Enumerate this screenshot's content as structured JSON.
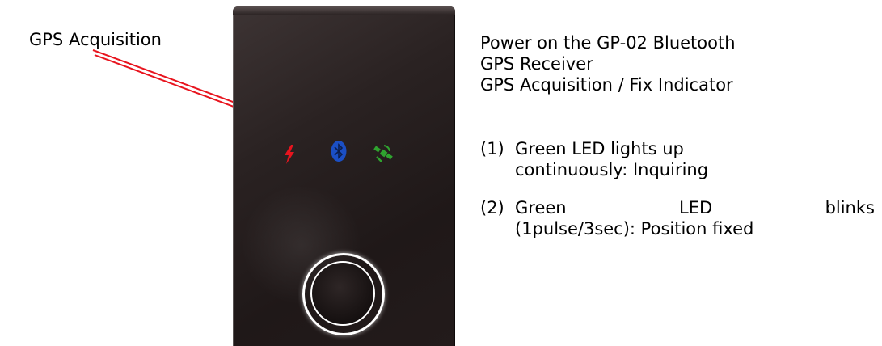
{
  "callout": {
    "label": "GPS Acquisition"
  },
  "device": {
    "indicators": [
      {
        "name": "power",
        "color": "#e8141e"
      },
      {
        "name": "bluetooth",
        "color": "#1b4fc4"
      },
      {
        "name": "gps",
        "color": "#2fa32f"
      }
    ]
  },
  "info": {
    "heading_lines": [
      "Power on the GP-02 Bluetooth",
      "GPS Receiver",
      "GPS Acquisition / Fix Indicator"
    ],
    "steps": [
      {
        "number": "(1)",
        "line1": "Green LED lights up",
        "line2": "continuously: Inquiring"
      },
      {
        "number": "(2)",
        "line1_words": [
          "Green",
          "LED",
          "blinks"
        ],
        "line2": "(1pulse/3sec): Position fixed"
      }
    ]
  },
  "colors": {
    "arrow": "#e8141e",
    "device_body": "#2a2222"
  }
}
